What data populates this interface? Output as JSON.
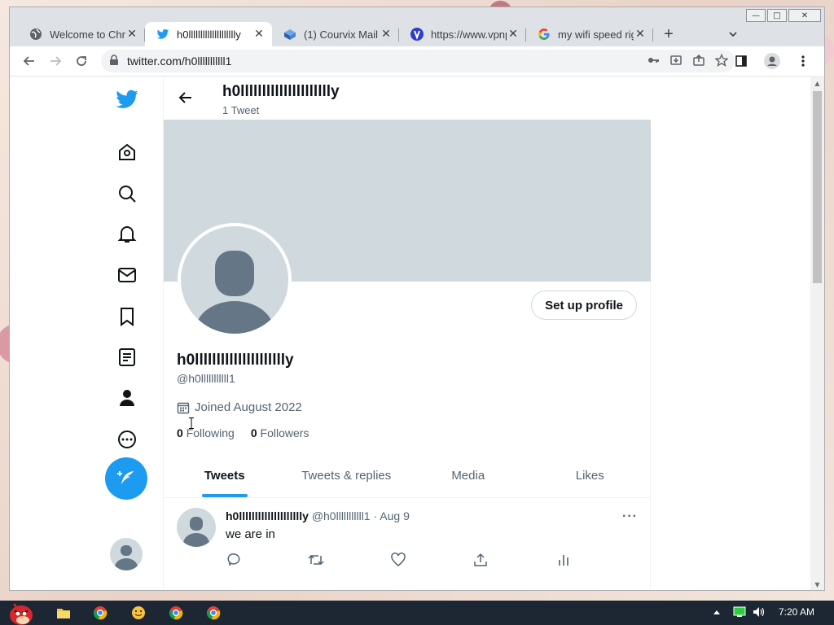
{
  "browser": {
    "tabs": [
      {
        "title": "Welcome to Chrome",
        "icon": "globe-icon",
        "active": false
      },
      {
        "title": "h0lllllllllllllllllllly",
        "icon": "twitter-bird-icon",
        "active": true
      },
      {
        "title": "(1) Courvix Mail",
        "icon": "courvix-icon",
        "active": false
      },
      {
        "title": "https://www.vpnpro",
        "icon": "vpn-icon",
        "active": false
      },
      {
        "title": "my wifi speed right",
        "icon": "google-icon",
        "active": false
      }
    ],
    "new_tab_label": "+",
    "url": "twitter.com/h0lllllllllll1",
    "window_controls": {
      "minimize": "—",
      "maximize": "□",
      "close": "✕"
    }
  },
  "twitter": {
    "nav": [
      "home-icon",
      "explore-icon",
      "notifications-icon",
      "messages-icon",
      "bookmarks-icon",
      "lists-icon",
      "profile-icon",
      "more-icon"
    ],
    "header": {
      "name": "h0llllllllllllllllllllly",
      "tweet_count": "1 Tweet"
    },
    "profile": {
      "setup_button": "Set up profile",
      "name": "h0llllllllllllllllllllly",
      "handle": "@h0lllllllllll1",
      "joined": "Joined August 2022",
      "following_count": "0",
      "following_label": "Following",
      "followers_count": "0",
      "followers_label": "Followers"
    },
    "tabs": [
      "Tweets",
      "Tweets & replies",
      "Media",
      "Likes"
    ],
    "tweet": {
      "name": "h0lllllllllllllllllllly",
      "handle": "@h0lllllllllll1",
      "sep": "·",
      "date": "Aug 9",
      "text": "we are in",
      "more": "···"
    }
  },
  "taskbar": {
    "clock": "7:20 AM"
  },
  "colors": {
    "twitter_blue": "#1d9bf0",
    "banner": "#cfd9de",
    "text": "#0f1419",
    "muted": "#536471"
  }
}
